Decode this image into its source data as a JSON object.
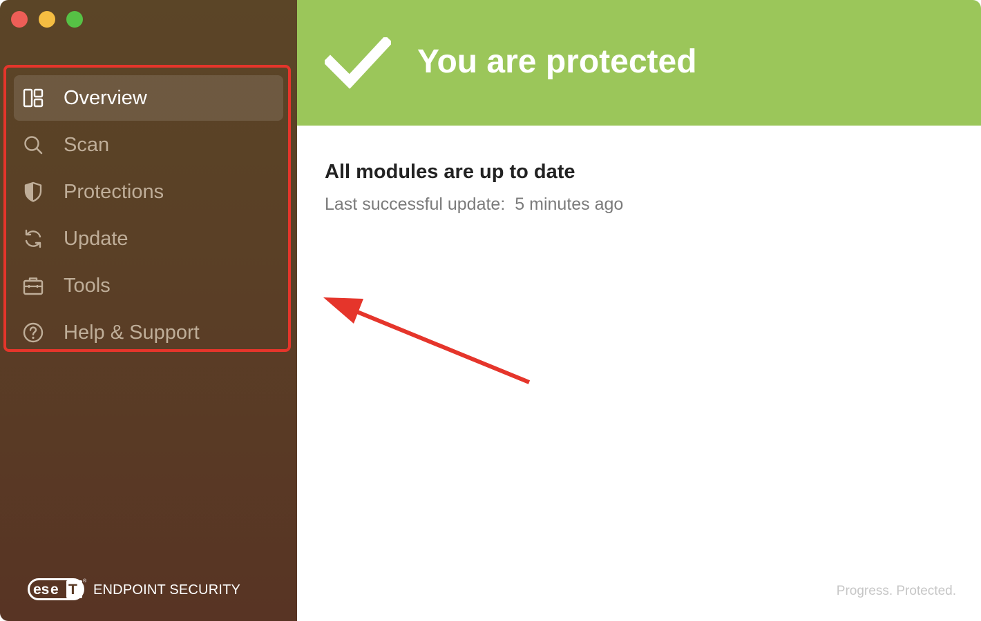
{
  "window": {
    "controls": [
      "close",
      "minimize",
      "zoom"
    ]
  },
  "sidebar": {
    "items": [
      {
        "label": "Overview",
        "icon": "dashboard-icon",
        "active": true
      },
      {
        "label": "Scan",
        "icon": "search-icon",
        "active": false
      },
      {
        "label": "Protections",
        "icon": "shield-icon",
        "active": false
      },
      {
        "label": "Update",
        "icon": "refresh-icon",
        "active": false
      },
      {
        "label": "Tools",
        "icon": "briefcase-icon",
        "active": false
      },
      {
        "label": "Help & Support",
        "icon": "help-circle-icon",
        "active": false
      }
    ],
    "brand": {
      "logo_text": "eset",
      "product": "ENDPOINT SECURITY"
    }
  },
  "main": {
    "banner": {
      "title": "You are protected",
      "icon": "checkmark-icon"
    },
    "status": {
      "title": "All modules are up to date",
      "meta_label": "Last successful update:",
      "meta_value": "5 minutes ago"
    },
    "tagline": "Progress. Protected."
  },
  "colors": {
    "sidebar_top": "#5b4527",
    "sidebar_bottom": "#583424",
    "banner_green": "#9bc65a",
    "annotation_red": "#e5352b",
    "inactive_label": "#bfae99"
  }
}
